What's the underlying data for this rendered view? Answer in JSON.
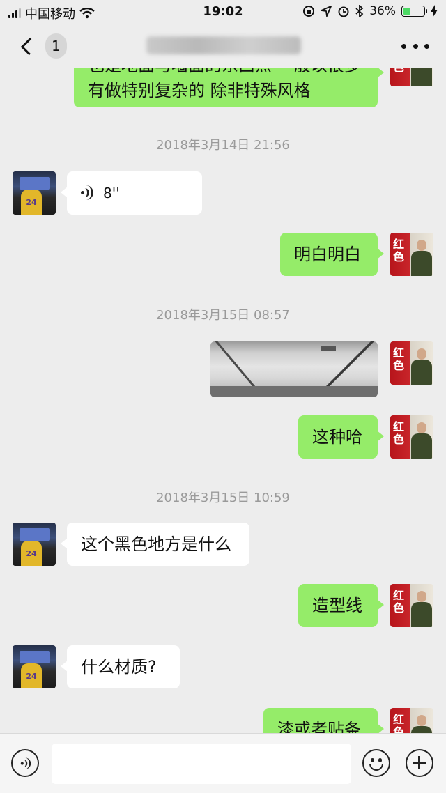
{
  "status_bar": {
    "carrier": "中国移动",
    "time": "19:02",
    "battery": "36%",
    "battery_level": 0.36,
    "icons": [
      "signal-icon",
      "wifi-icon",
      "rotation-lock-icon",
      "location-icon",
      "alarm-icon",
      "bluetooth-icon",
      "battery-icon",
      "charging-icon"
    ]
  },
  "nav": {
    "unread_count": "1",
    "icons": [
      "chevron-left-icon",
      "more-icon"
    ]
  },
  "messages": {
    "m1_line1": "也是地面与墙面的东西点 一般以很多",
    "m1_line2": "有做特别复杂的  除非特殊风格",
    "t1": "2018年3月14日 21:56",
    "m2_voice": "8''",
    "m3": "明白明白",
    "t2": "2018年3月15日 08:57",
    "m5": "这种哈",
    "t3": "2018年3月15日 10:59",
    "m6": "这个黑色地方是什么",
    "m7": "造型线",
    "m8": "什么材质?",
    "m9": "漆或者贴条"
  },
  "avatars": {
    "other_jersey_number": "24",
    "self_stamp": "红色八月"
  },
  "input_bar": {
    "icons": [
      "voice-icon",
      "emoji-icon",
      "plus-icon"
    ],
    "value": ""
  },
  "colors": {
    "sent_bubble": "#95ec69",
    "received_bubble": "#ffffff",
    "background": "#ededed"
  }
}
